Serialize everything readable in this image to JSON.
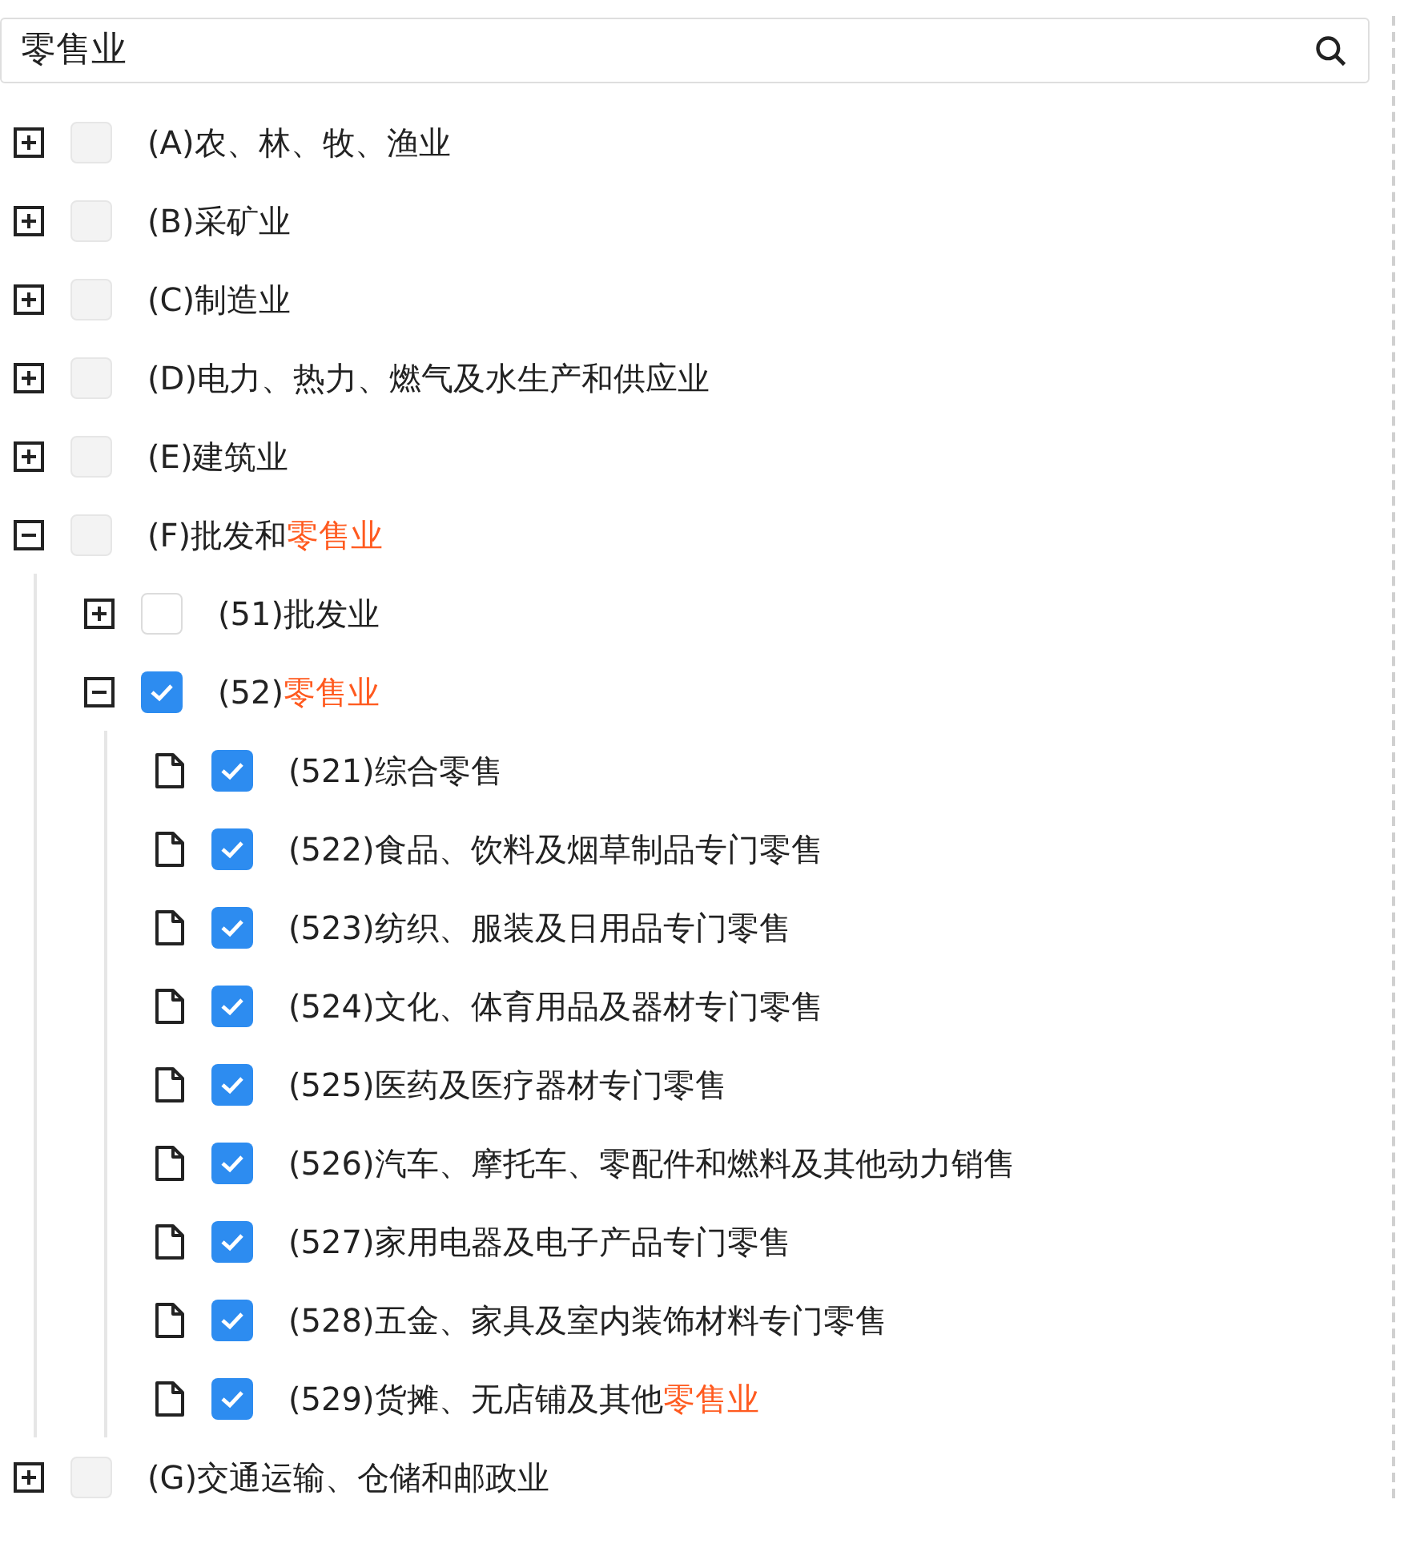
{
  "search": {
    "value": "零售业"
  },
  "tree": [
    {
      "label": "(A)农、林、牧、渔业",
      "expanded": false,
      "checked": false,
      "disabled": true
    },
    {
      "label": "(B)采矿业",
      "expanded": false,
      "checked": false,
      "disabled": true
    },
    {
      "label": "(C)制造业",
      "expanded": false,
      "checked": false,
      "disabled": true
    },
    {
      "label": "(D)电力、热力、燃气及水生产和供应业",
      "expanded": false,
      "checked": false,
      "disabled": true
    },
    {
      "label": "(E)建筑业",
      "expanded": false,
      "checked": false,
      "disabled": true
    },
    {
      "label": "(F)批发和",
      "match": "零售业",
      "expanded": true,
      "checked": false,
      "disabled": true,
      "children": [
        {
          "label": "(51)批发业",
          "expanded": false,
          "checked": false,
          "disabled": false
        },
        {
          "label": "(52)",
          "match": "零售业",
          "expanded": true,
          "checked": true,
          "disabled": false,
          "children": [
            {
              "label": "(521)综合零售",
              "checked": true,
              "disabled": false
            },
            {
              "label": "(522)食品、饮料及烟草制品专门零售",
              "checked": true,
              "disabled": false
            },
            {
              "label": "(523)纺织、服装及日用品专门零售",
              "checked": true,
              "disabled": false
            },
            {
              "label": "(524)文化、体育用品及器材专门零售",
              "checked": true,
              "disabled": false
            },
            {
              "label": "(525)医药及医疗器材专门零售",
              "checked": true,
              "disabled": false
            },
            {
              "label": "(526)汽车、摩托车、零配件和燃料及其他动力销售",
              "checked": true,
              "disabled": false
            },
            {
              "label": "(527)家用电器及电子产品专门零售",
              "checked": true,
              "disabled": false
            },
            {
              "label": "(528)五金、家具及室内装饰材料专门零售",
              "checked": true,
              "disabled": false
            },
            {
              "label": "(529)货摊、无店铺及其他",
              "match": "零售业",
              "checked": true,
              "disabled": false
            }
          ]
        }
      ]
    },
    {
      "label": "(G)交通运输、仓储和邮政业",
      "expanded": false,
      "checked": false,
      "disabled": true
    }
  ]
}
